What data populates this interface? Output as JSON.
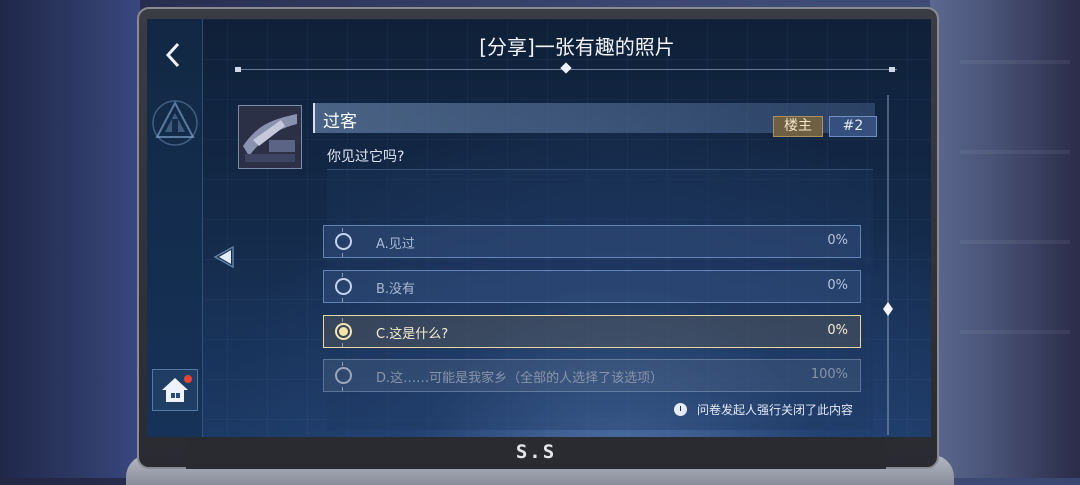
{
  "post": {
    "title": "[分享]一张有趣的照片",
    "author": "过客",
    "owner_badge": "楼主",
    "floor": "#2",
    "question": "你见过它吗?"
  },
  "options": [
    {
      "label": "A.见过",
      "percent": "0%",
      "state": "normal"
    },
    {
      "label": "B.没有",
      "percent": "0%",
      "state": "normal"
    },
    {
      "label": "C.这是什么?",
      "percent": "0%",
      "state": "selected"
    },
    {
      "label": "D.这……可能是我家乡（全部的人选择了该选项）",
      "percent": "100%",
      "state": "disabled"
    }
  ],
  "notice": "问卷发起人强行关闭了此内容",
  "device_logo": "S.S",
  "icons": {
    "back": "back-arrow-icon",
    "home": "home-icon",
    "prev": "triangle-left-icon",
    "clock": "clock-icon",
    "emblem": "triangle-emblem-icon"
  },
  "colors": {
    "selected_border": "#e8d8a0",
    "owner_badge": "#6f6044",
    "floor_badge": "#35507e",
    "notification_dot": "#e2463a"
  }
}
